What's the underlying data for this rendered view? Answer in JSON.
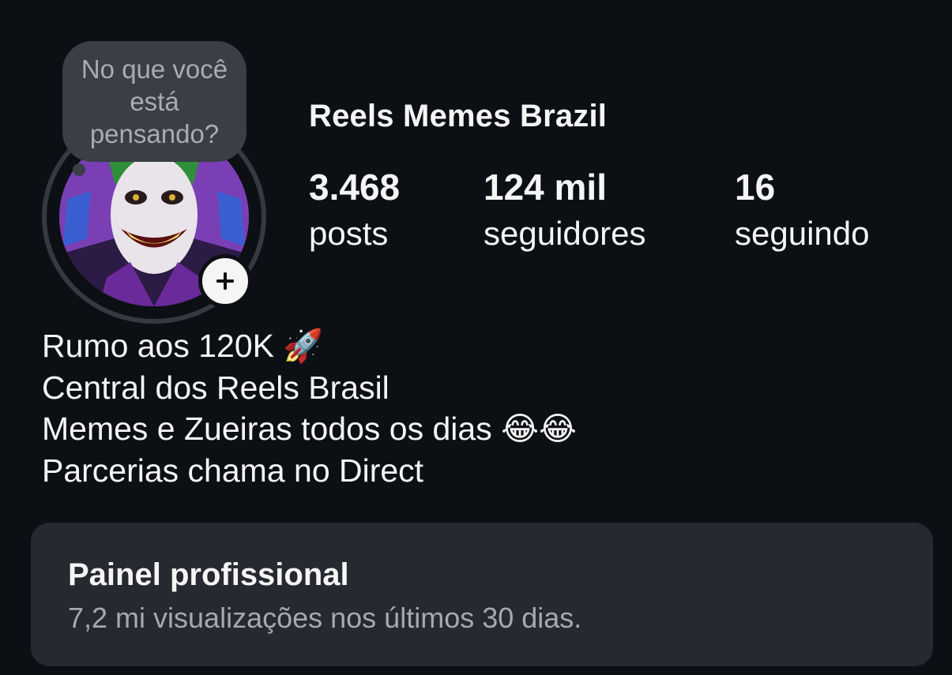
{
  "note": {
    "placeholder": "No que você está pensando?"
  },
  "avatar": {
    "icon": "joker-avatar-image"
  },
  "add_story": {
    "icon": "plus-icon"
  },
  "profile": {
    "name": "Reels Memes Brazil"
  },
  "stats": [
    {
      "value": "3.468",
      "label": "posts"
    },
    {
      "value": "124 mil",
      "label": "seguidores"
    },
    {
      "value": "16",
      "label": "seguindo"
    }
  ],
  "bio": {
    "lines": [
      "Rumo aos 120K 🚀",
      "Central dos Reels Brasil",
      "Memes e Zueiras todos os dias 😂😂",
      "Parcerias chama no Direct"
    ]
  },
  "dashboard": {
    "title": "Painel profissional",
    "subtitle": "7,2 mi visualizações nos últimos 30 dias."
  },
  "colors": {
    "background": "#0c1014",
    "card": "#26292f",
    "note_bubble": "#3a3e45",
    "muted_text": "#a6aab0"
  }
}
